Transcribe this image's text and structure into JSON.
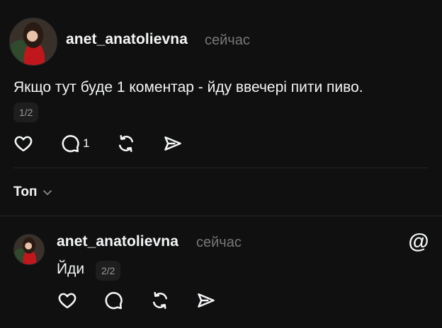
{
  "post": {
    "username": "anet_anatolievna",
    "time": "сейчас",
    "text": "Якщо тут буде 1 коментар - йду ввечері пити пиво.",
    "counter": "1/2",
    "actions": {
      "like_icon": "heart-icon",
      "comment_icon": "comment-icon",
      "comment_count": "1",
      "repost_icon": "repost-icon",
      "share_icon": "send-icon"
    }
  },
  "sort": {
    "label": "Топ",
    "icon": "chevron-down-icon"
  },
  "reply": {
    "username": "anet_anatolievna",
    "time": "сейчас",
    "text": "Йди",
    "counter": "2/2",
    "logo_icon": "threads-logo-icon",
    "actions": {
      "like_icon": "heart-icon",
      "comment_icon": "comment-icon",
      "repost_icon": "repost-icon",
      "share_icon": "send-icon"
    }
  },
  "colors": {
    "background": "#101010",
    "text": "#f3f5f7",
    "muted": "#777777",
    "divider": "#262626"
  }
}
